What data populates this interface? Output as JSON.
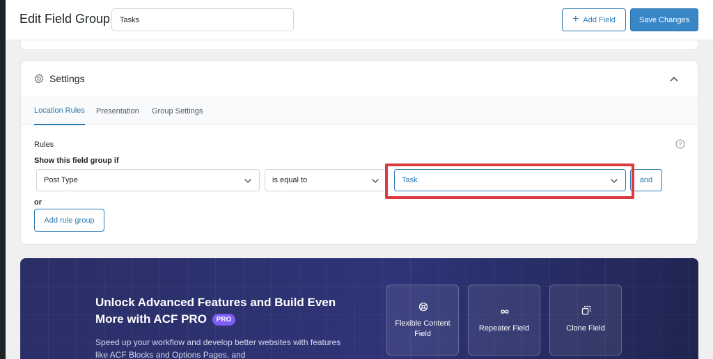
{
  "header": {
    "title": "Edit Field Group",
    "group_name": "Tasks",
    "add_field_label": "Add Field",
    "save_label": "Save Changes"
  },
  "settings": {
    "title": "Settings",
    "tabs": [
      {
        "label": "Location Rules",
        "active": true
      },
      {
        "label": "Presentation",
        "active": false
      },
      {
        "label": "Group Settings",
        "active": false
      }
    ],
    "rules_label": "Rules",
    "show_if_label": "Show this field group if",
    "rule": {
      "param": "Post Type",
      "operator": "is equal to",
      "value": "Task"
    },
    "and_label": "and",
    "or_label": "or",
    "add_rule_group_label": "Add rule group"
  },
  "promo": {
    "title": "Unlock Advanced Features and Build Even More with ACF PRO",
    "badge": "PRO",
    "description": "Speed up your workflow and develop better websites with features like ACF Blocks and Options Pages, and",
    "features": [
      {
        "label": "Flexible Content Field",
        "icon": "flexible-content-icon"
      },
      {
        "label": "Repeater Field",
        "icon": "infinity-icon"
      },
      {
        "label": "Clone Field",
        "icon": "clone-icon"
      }
    ]
  },
  "colors": {
    "accent": "#2c7ab1",
    "save_button": "#3a87c8",
    "highlight": "#dc3a3f",
    "promo_bg": "#2e3477",
    "pro_badge": "#7d5df5"
  }
}
